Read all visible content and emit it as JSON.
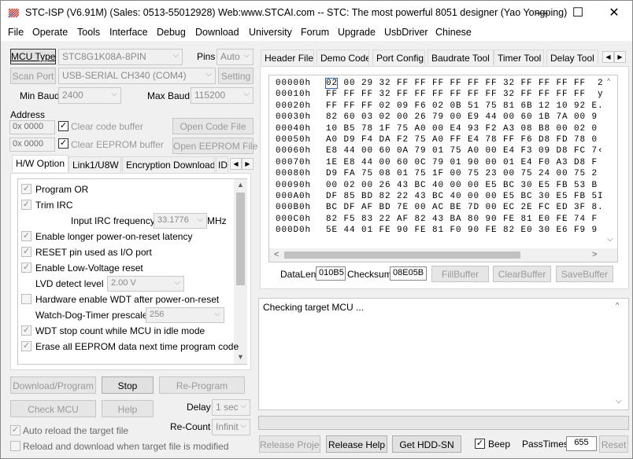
{
  "window": {
    "title": "STC-ISP (V6.91M) (Sales: 0513-55012928) Web:www.STCAI.com  -- STC: The most powerful 8051 designer (Yao Yongping)",
    "minimize": "—",
    "maximize": "☐",
    "close": "✕"
  },
  "menu": [
    "File",
    "Operate",
    "Tools",
    "Interface",
    "Debug",
    "Download",
    "University",
    "Forum",
    "Upgrade",
    "UsbDriver",
    "Chinese"
  ],
  "left": {
    "mcu_type_label": "MCU Type",
    "mcu_type_value": "STC8G1K08A-8PIN",
    "pins_label": "Pins",
    "pins_value": "Auto",
    "scan_port_label": "Scan Port",
    "port_value": "USB-SERIAL CH340 (COM4)",
    "setting_label": "Setting",
    "min_baud_label": "Min Baud",
    "min_baud_value": "2400",
    "max_baud_label": "Max Baud",
    "max_baud_value": "115200",
    "address_label": "Address",
    "address1": "0x 0000",
    "address2": "0x 0000",
    "clear_code_label": "Clear code buffer",
    "clear_eeprom_label": "Clear EEPROM buffer",
    "open_code_label": "Open Code File",
    "open_eeprom_label": "Open EEPROM File"
  },
  "option_tabs": [
    "H/W Option",
    "Link1/U8W",
    "Encryption Download",
    "ID"
  ],
  "options": {
    "program_or": "Program OR",
    "trim_irc": "Trim IRC",
    "irc_freq_label": "Input IRC frequency",
    "irc_freq_value": "33.1776",
    "irc_unit": "MHz",
    "longer_por": "Enable longer power-on-reset latency",
    "reset_io": "RESET pin used as I/O port",
    "low_voltage": "Enable Low-Voltage reset",
    "lvd_label": "LVD detect level",
    "lvd_value": "2.00 V",
    "hw_wdt": "Hardware enable WDT after power-on-reset",
    "wdt_prescaler_label": "Watch-Dog-Timer prescaler",
    "wdt_prescaler_value": "256",
    "wdt_stop": "WDT stop count while MCU in idle mode",
    "erase_eeprom": "Erase all EEPROM data next time program code"
  },
  "bottom_left": {
    "download_label": "Download/Program",
    "stop_label": "Stop",
    "reprogram_label": "Re-Program",
    "check_mcu_label": "Check MCU",
    "help_label": "Help",
    "delay_label": "Delay",
    "delay_value": "1 sec",
    "auto_reload_label": "Auto reload the target file",
    "recount_label": "Re-Count",
    "recount_value": "Infinit",
    "reload_modified_label": "Reload and download when target file is modified"
  },
  "right_tabs": [
    "Header File",
    "Demo Code",
    "Port Config",
    "Baudrate Tool",
    "Timer Tool",
    "Delay Tool"
  ],
  "hex": {
    "rows": [
      {
        "addr": "00000h",
        "bytes": "02 00 29 32 FF FF FF FF FF FF 32 FF FF FF FF",
        "ascii": "2"
      },
      {
        "addr": "00010h",
        "bytes": "FF FF FF 32 FF FF FF FF FF FF 32 FF FF FF FF",
        "ascii": "y"
      },
      {
        "addr": "00020h",
        "bytes": "FF FF FF 02 09 F6 02 0B 51 75 81 6B 12 10 92 E5",
        "ascii": "."
      },
      {
        "addr": "00030h",
        "bytes": "82 60 03 02 00 26 79 00 E9 44 00 60 1B 7A 00 90",
        "ascii": ""
      },
      {
        "addr": "00040h",
        "bytes": "10 B5 78 1F 75 A0 00 E4 93 F2 A3 08 B8 00 02 05",
        "ascii": ""
      },
      {
        "addr": "00050h",
        "bytes": "A0 D9 F4 DA F2 75 A0 FF E4 78 FF F6 D8 FD 78 00",
        "ascii": ""
      },
      {
        "addr": "00060h",
        "bytes": "E8 44 00 60 0A 79 01 75 A0 00 E4 F3 09 D8 FC 78",
        "ascii": "‹"
      },
      {
        "addr": "00070h",
        "bytes": "1E E8 44 00 60 0C 79 01 90 00 01 E4 F0 A3 D8 FC",
        "ascii": ""
      },
      {
        "addr": "00080h",
        "bytes": "D9 FA 75 08 01 75 1F 00 75 23 00 75 24 00 75 25",
        "ascii": ""
      },
      {
        "addr": "00090h",
        "bytes": "00 02 00 26 43 BC 40 00 00 E5 BC 30 E5 FB 53 BC",
        "ascii": ""
      },
      {
        "addr": "000A0h",
        "bytes": "DF 85 BD 82 22 43 BC 40 00 00 E5 BC 30 E5 FB 53",
        "ascii": "I"
      },
      {
        "addr": "000B0h",
        "bytes": "BC DF AF BD 7E 00 AC BE 7D 00 EC 2E FC ED 3F 8C",
        "ascii": "."
      },
      {
        "addr": "000C0h",
        "bytes": "82 F5 83 22 AF 82 43 BA 80 90 FE 81 E0 FE 74 F0",
        "ascii": ""
      },
      {
        "addr": "000D0h",
        "bytes": "5E 44 01 FE 90 FE 81 F0 90 FE 82 E0 30 E6 F9 90",
        "ascii": ""
      }
    ],
    "datalen_label": "DataLen",
    "datalen_value": "010B5",
    "checksum_label": "Checksum",
    "checksum_value": "08E05B",
    "fill_label": "FillBuffer",
    "clear_label": "ClearBuffer",
    "save_label": "SaveBuffer"
  },
  "log": {
    "text": "Checking target MCU ..."
  },
  "bottom_right": {
    "release_project_label": "Release Project",
    "release_help_label": "Release Help",
    "get_hdd_label": "Get HDD-SN",
    "beep_label": "Beep",
    "passtimes_label": "PassTimes",
    "passtimes_value": "655",
    "reset_label": "Reset"
  }
}
